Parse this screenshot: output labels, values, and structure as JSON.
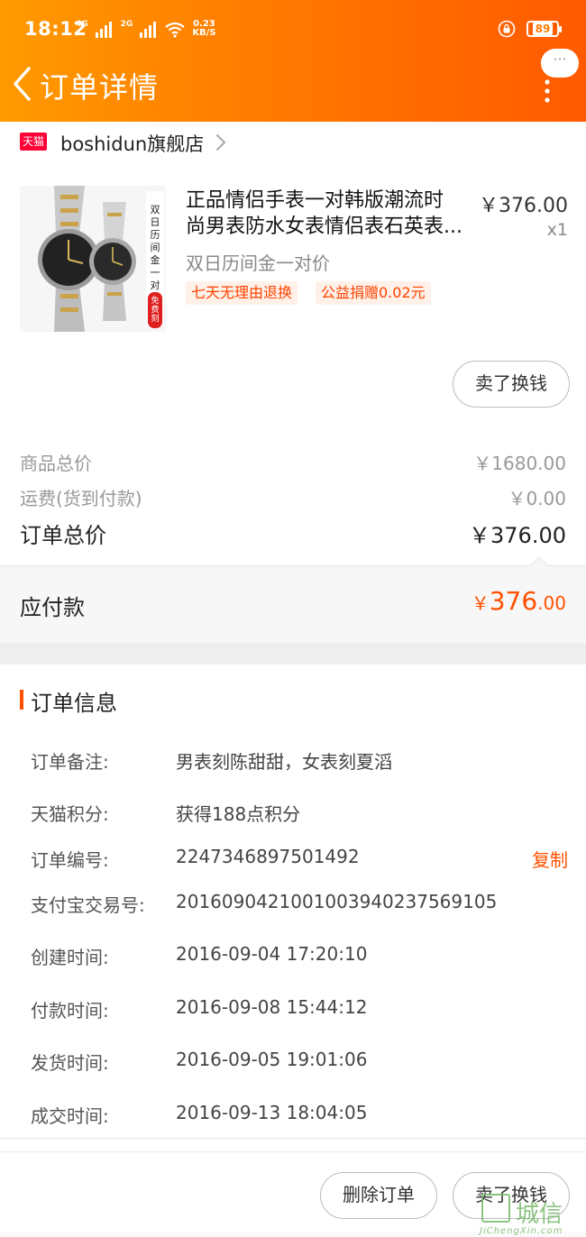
{
  "status": {
    "time": "18:12",
    "net1": "4G",
    "net2": "2G",
    "speed_top": "0.23",
    "speed_unit": "KB/S",
    "battery": "89"
  },
  "nav": {
    "title": "订单详情",
    "bubble": "···"
  },
  "shop": {
    "badge": "天猫",
    "name": "boshidun旗舰店"
  },
  "product": {
    "title_line1": "正品情侣手表一对韩版潮流时",
    "title_line2": "尚男表防水女表情侣表石英表...",
    "price": "￥376.00",
    "qty": "x1",
    "sku": "双日历间金一对价",
    "tag1": "七天无理由退换",
    "tag2": "公益捐赠0.02元",
    "thumb_caption_top": "双日历间金一对",
    "thumb_caption_bottom": "免费刻字",
    "sell_button": "卖了换钱"
  },
  "summary": {
    "goods_label": "商品总价",
    "goods_value": "￥1680.00",
    "shipping_label": "运费(货到付款)",
    "shipping_value": "￥0.00",
    "total_label": "订单总价",
    "total_value": "￥376.00",
    "payable_label": "应付款",
    "payable_currency": "￥",
    "payable_int": "376",
    "payable_dec": ".00"
  },
  "order_info": {
    "title": "订单信息",
    "rows": [
      {
        "label": "订单备注:",
        "value": "男表刻陈甜甜，女表刻夏滔"
      },
      {
        "label": "天猫积分:",
        "value": "获得188点积分"
      },
      {
        "label": "订单编号:",
        "value": "2247346897501492"
      },
      {
        "label": "支付宝交易号:",
        "value": "2016090421001003940237569105"
      },
      {
        "label": "创建时间:",
        "value": "2016-09-04 17:20:10"
      },
      {
        "label": "付款时间:",
        "value": "2016-09-08 15:44:12"
      },
      {
        "label": "发货时间:",
        "value": "2016-09-05 19:01:06"
      },
      {
        "label": "成交时间:",
        "value": "2016-09-13 18:04:05"
      }
    ],
    "copy_label": "复制"
  },
  "actions": {
    "delete": "删除订单",
    "sell": "卖了换钱"
  },
  "watermark": {
    "text": "城信",
    "url": "JiChengXin.com"
  },
  "colors": {
    "accent": "#ff5000",
    "header_start": "#ff9a00",
    "header_end": "#ff5a00"
  }
}
